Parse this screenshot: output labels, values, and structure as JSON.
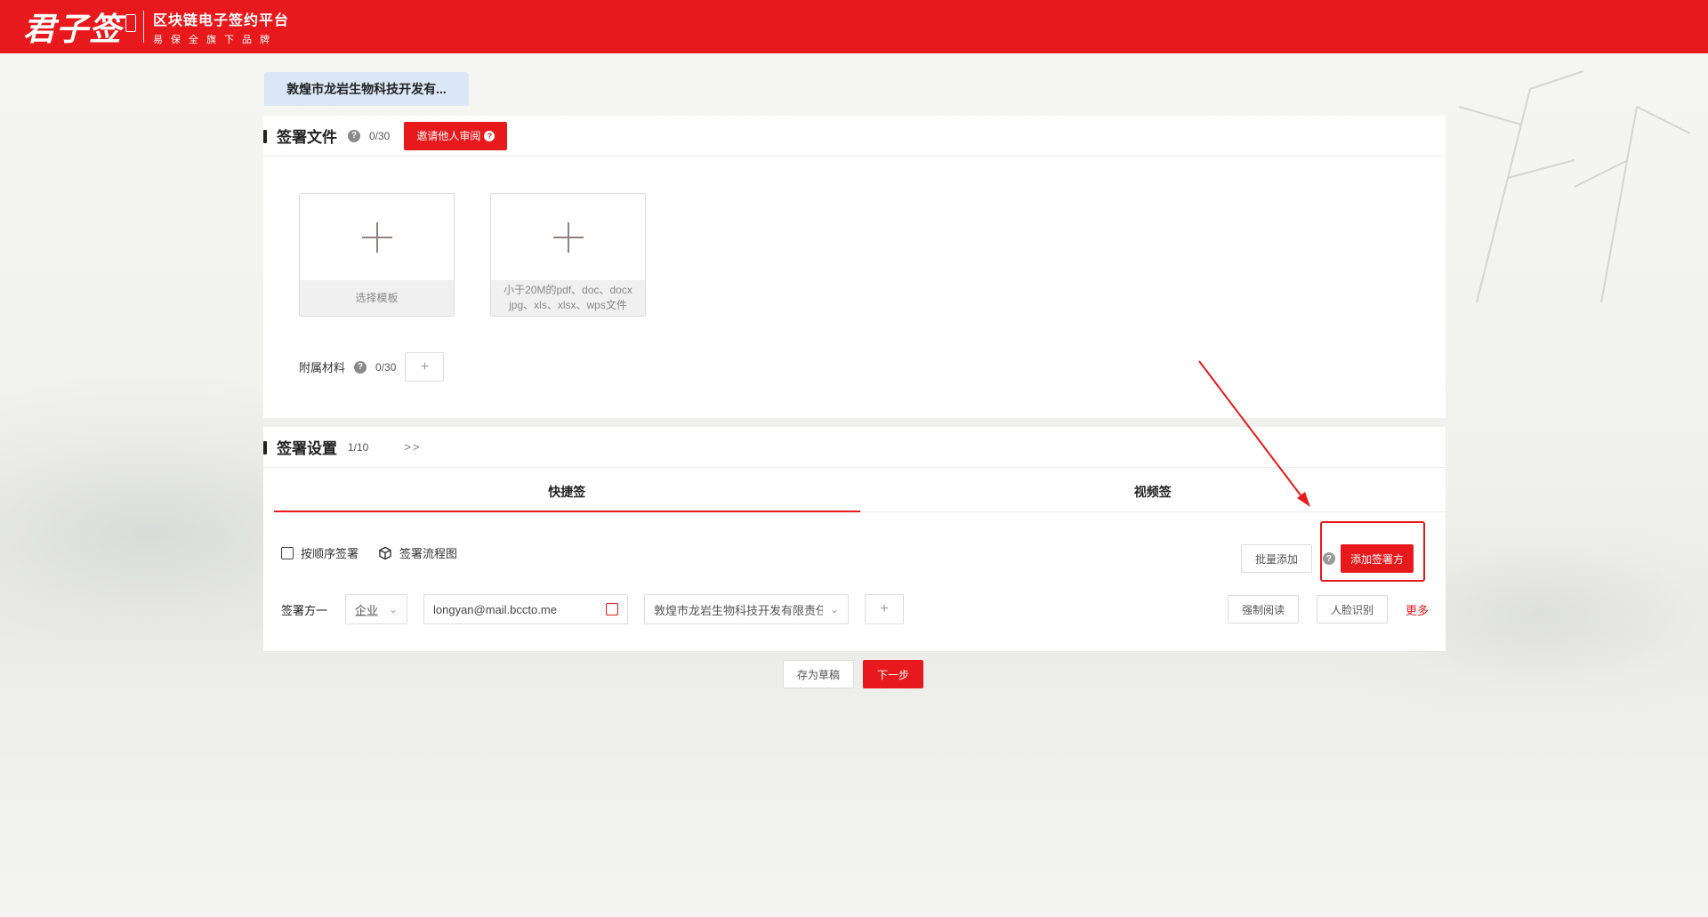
{
  "header": {
    "logo_main": "君子签",
    "logo_title": "区块链电子签约平台",
    "logo_sub": "易保全旗下品牌",
    "brand_color": "#e8191c"
  },
  "company_tab": {
    "label": "敦煌市龙岩生物科技开发有..."
  },
  "files_section": {
    "title": "签署文件",
    "count": "0/30",
    "invite_button": "邀请他人审阅",
    "template_card_caption": "选择模板",
    "upload_card_caption_line1": "小于20M的pdf、doc、docx",
    "upload_card_caption_line2": "jpg、xls、xlsx、wps文件",
    "attach_label": "附属材料",
    "attach_count": "0/30"
  },
  "settings_section": {
    "title": "签署设置",
    "count": "1/10",
    "arrows": ">>",
    "tabs": [
      {
        "label": "快捷签",
        "active": true
      },
      {
        "label": "视频签",
        "active": false
      }
    ],
    "sequential_label": "按顺序签署",
    "flowchart_label": "签署流程图",
    "batch_add_button": "批量添加",
    "add_signer_button": "添加签署方",
    "signer": {
      "label": "签署方一",
      "type_value": "企业",
      "email_value": "longyan@mail.bccto.me",
      "company_value": "敦煌市龙岩生物科技开发有限责任公司",
      "force_read_button": "强制阅读",
      "face_id_button": "人脸识别",
      "more_link": "更多"
    }
  },
  "footer": {
    "save_draft_button": "存为草稿",
    "next_button": "下一步"
  }
}
